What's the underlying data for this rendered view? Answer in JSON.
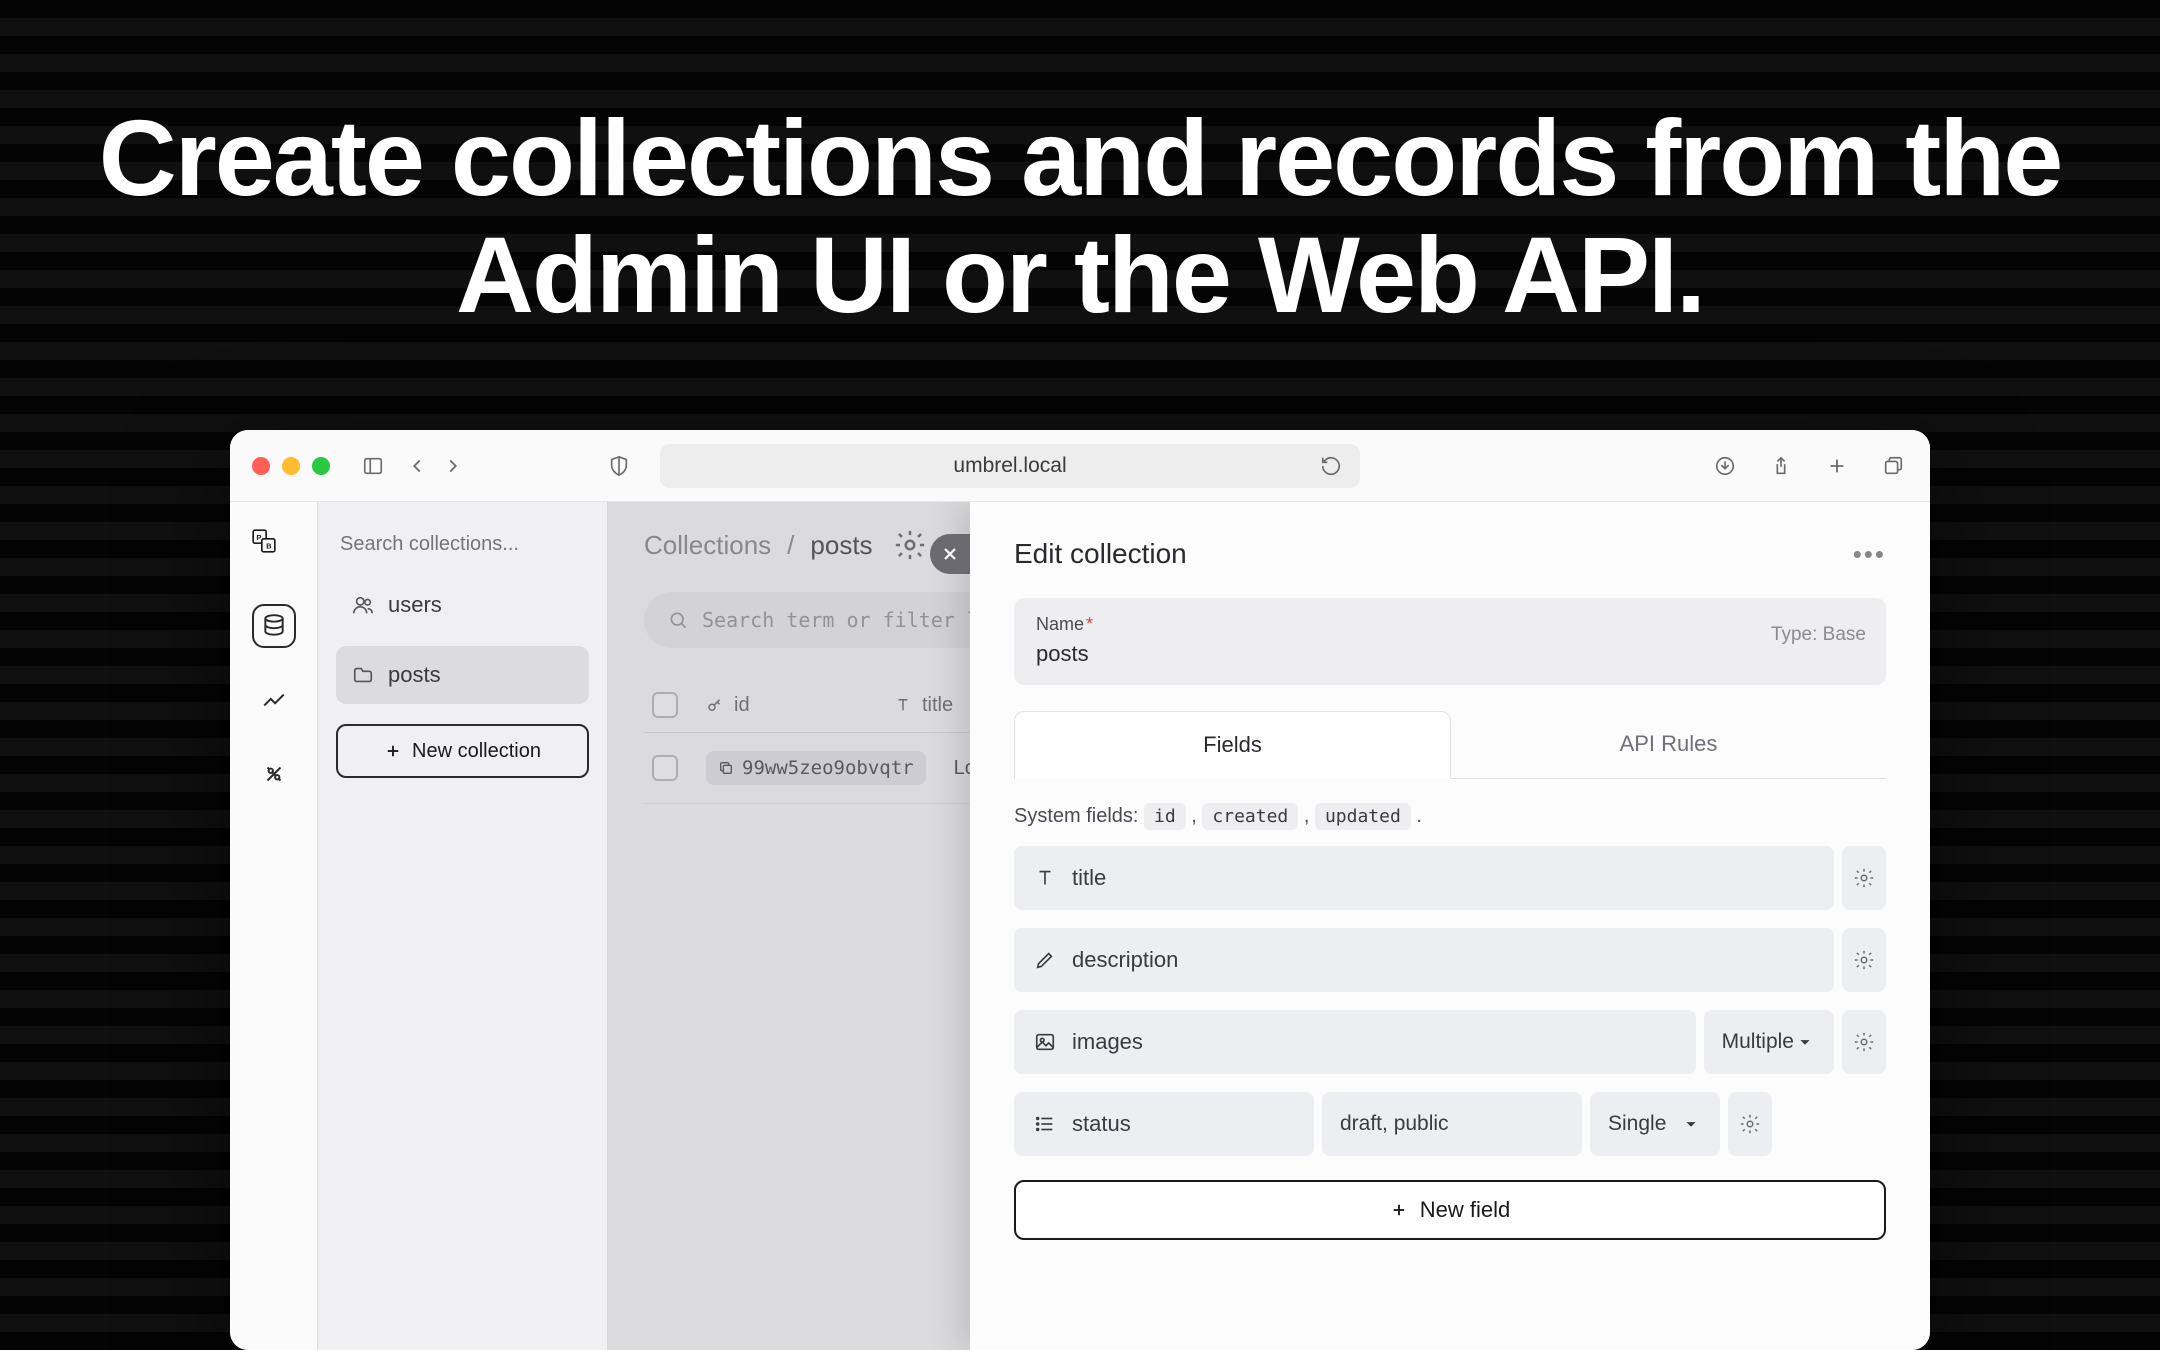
{
  "headline": "Create collections and records from the Admin UI or the Web API.",
  "browser": {
    "url": "umbrel.local"
  },
  "sidebar": {
    "search_placeholder": "Search collections...",
    "items": [
      {
        "label": "users"
      },
      {
        "label": "posts"
      }
    ],
    "new_collection_label": "New collection"
  },
  "breadcrumbs": {
    "root": "Collections",
    "sep": "/",
    "current": "posts"
  },
  "records": {
    "search_placeholder": "Search term or filter like c",
    "columns": [
      {
        "label": "id"
      },
      {
        "label": "title"
      }
    ],
    "rows": [
      {
        "id": "99ww5zeo9obvqtr",
        "title": "Lorem"
      }
    ]
  },
  "panel": {
    "title": "Edit collection",
    "name_label": "Name",
    "name_value": "posts",
    "type_label": "Type: Base",
    "tabs": [
      {
        "label": "Fields"
      },
      {
        "label": "API Rules"
      }
    ],
    "system_fields_label": "System fields:",
    "system_fields": [
      "id",
      "created",
      "updated"
    ],
    "fields": [
      {
        "icon": "text",
        "name": "title"
      },
      {
        "icon": "pencil",
        "name": "description"
      },
      {
        "icon": "image",
        "name": "images",
        "multi": "Multiple"
      },
      {
        "icon": "list",
        "name": "status",
        "values": "draft, public",
        "multi": "Single"
      }
    ],
    "new_field_label": "New field"
  }
}
